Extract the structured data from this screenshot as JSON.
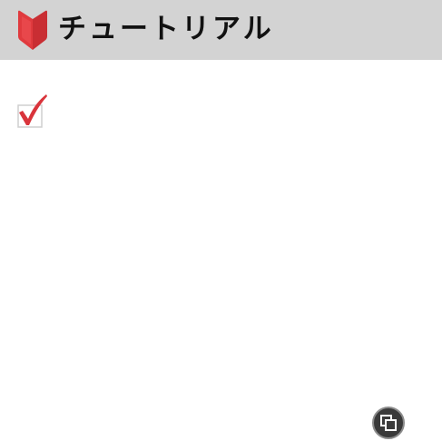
{
  "header": {
    "title": "チュートリアル",
    "icon": "beginner-mark-icon",
    "background": "#d3d3d3"
  },
  "content": {
    "task_checkbox": {
      "checked": true,
      "icon": "checkmark-icon",
      "check_color": "#d9343b"
    }
  },
  "floating_button": {
    "icon": "overlay-window-icon",
    "background": "#3a3a3a"
  }
}
